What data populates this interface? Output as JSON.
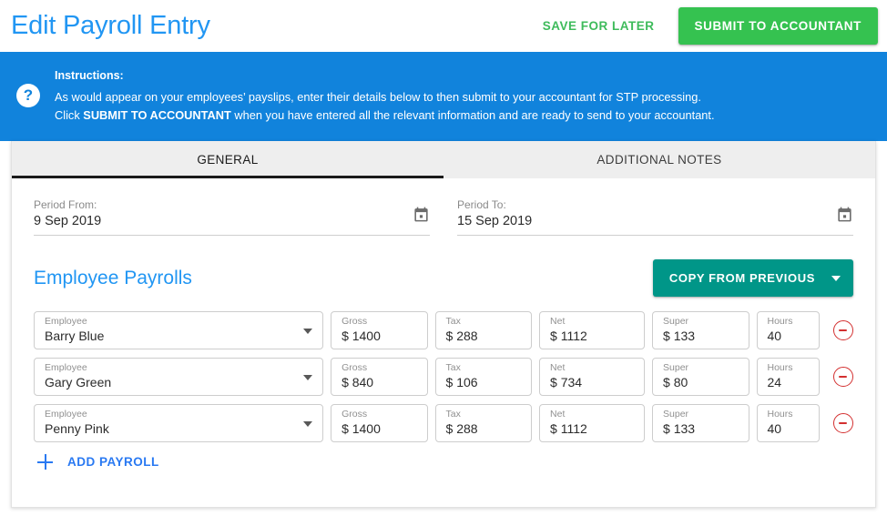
{
  "header": {
    "title": "Edit Payroll Entry",
    "save_for_later_label": "SAVE FOR LATER",
    "submit_label": "SUBMIT TO ACCOUNTANT"
  },
  "instructions": {
    "icon": "question-mark-icon",
    "title": "Instructions:",
    "line1": "As would appear on your employees’ payslips, enter their details below to then submit to your accountant for STP processing.",
    "line2_pre": "Click ",
    "line2_bold": "SUBMIT TO ACCOUNTANT",
    "line2_post": " when you have entered all the relevant information and are ready to send to your accountant."
  },
  "tabs": [
    {
      "label": "GENERAL",
      "active": true
    },
    {
      "label": "ADDITIONAL NOTES",
      "active": false
    }
  ],
  "period": {
    "from_label": "Period From:",
    "from_value": "9 Sep 2019",
    "to_label": "Period To:",
    "to_value": "15 Sep 2019",
    "calendar_icon": "calendar-icon"
  },
  "payrolls_section": {
    "title": "Employee Payrolls",
    "copy_from_previous_label": "COPY FROM PREVIOUS",
    "add_payroll_label": "ADD PAYROLL"
  },
  "field_labels": {
    "employee": "Employee",
    "gross": "Gross",
    "tax": "Tax",
    "net": "Net",
    "super": "Super",
    "hours": "Hours"
  },
  "rows": [
    {
      "employee": "Barry Blue",
      "gross": "$ 1400",
      "tax": "$ 288",
      "net": "$ 1112",
      "super": "$ 133",
      "hours": "40"
    },
    {
      "employee": "Gary Green",
      "gross": "$ 840",
      "tax": "$ 106",
      "net": "$ 734",
      "super": "$ 80",
      "hours": "24"
    },
    {
      "employee": "Penny Pink",
      "gross": "$ 1400",
      "tax": "$ 288",
      "net": "$ 1112",
      "super": "$ 133",
      "hours": "40"
    }
  ],
  "colors": {
    "title_blue": "#2196F3",
    "banner_blue": "#1183DC",
    "submit_green": "#35C250",
    "flat_green": "#3EBB5B",
    "teal": "#009688",
    "remove_red": "#D32F2F",
    "link_blue": "#2979F2"
  }
}
